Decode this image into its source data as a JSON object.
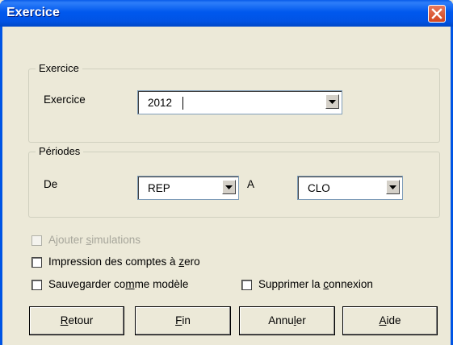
{
  "window": {
    "title": "Exercice"
  },
  "exercice_group": {
    "label": "Exercice",
    "field_label": "Exercice",
    "value": "2012"
  },
  "periodes_group": {
    "label": "Périodes",
    "de_label": "De",
    "de_value": "REP",
    "a_label": "A",
    "a_value": "CLO"
  },
  "options": {
    "ajouter_simulations": {
      "pre": "Ajouter ",
      "u": "s",
      "post": "imulations",
      "checked": false,
      "enabled": false
    },
    "impression": {
      "pre": "Impression des comptes à ",
      "u": "z",
      "post": "ero",
      "checked": false,
      "enabled": true
    },
    "sauvegarder": {
      "pre": "Sauvegarder co",
      "u": "m",
      "post": "me modèle",
      "checked": false,
      "enabled": true
    },
    "supprimer": {
      "pre": "Supprimer la ",
      "u": "c",
      "post": "onnexion",
      "checked": false,
      "enabled": true
    }
  },
  "buttons": {
    "retour": {
      "u": "R",
      "post": "etour"
    },
    "fin": {
      "u": "F",
      "post": "in"
    },
    "annuler": {
      "pre": "Annu",
      "u": "l",
      "post": "er"
    },
    "aide": {
      "u": "A",
      "post": "ide"
    }
  },
  "colors": {
    "titlebar": "#0055e5",
    "face": "#ece9d8",
    "close": "#d2451f"
  }
}
